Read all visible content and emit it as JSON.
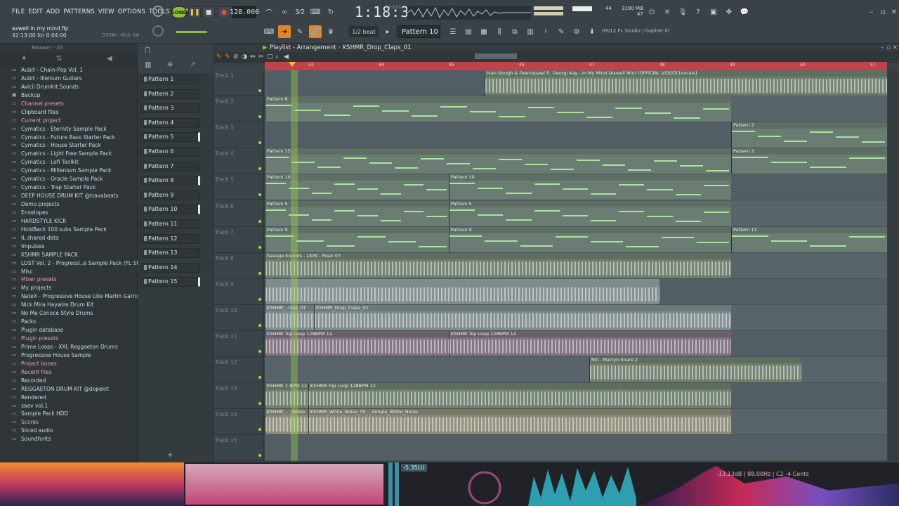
{
  "menu": [
    "FILE",
    "EDIT",
    "ADD",
    "PATTERNS",
    "VIEW",
    "OPTIONS",
    "TOOLS",
    "HELP"
  ],
  "project": {
    "name": "axwell in my mind.flp",
    "time": "42:13:00 for 0:04:00",
    "hint": "D3FAI - Kick 04"
  },
  "transport": {
    "song_label": "SONG",
    "tempo": "128.000",
    "time": "1:18:31",
    "time_unit": "M:S:CS"
  },
  "stats": {
    "poly": "44",
    "mem": "3190 MB",
    "cpu": "47"
  },
  "toolbar": {
    "snap": "1/2 beat",
    "pattern": "Pattern 10",
    "news": "09/12  FL Studio | Gopher it!"
  },
  "browser": {
    "header": "Browser - All",
    "items": [
      {
        "label": "Aubit - Chain-Pop Vol. 1",
        "kind": "folder"
      },
      {
        "label": "Aubit - Illenium Guitars",
        "kind": "folder"
      },
      {
        "label": "Avicii Drumkit.Sounds",
        "kind": "folder"
      },
      {
        "label": "Backup",
        "kind": "folder-open"
      },
      {
        "label": "Channel presets",
        "kind": "pink"
      },
      {
        "label": "Clipboard files",
        "kind": "folder"
      },
      {
        "label": "Current project",
        "kind": "pink"
      },
      {
        "label": "Cymatics - Eternity Sample Pack",
        "kind": "folder"
      },
      {
        "label": "Cymatics - Future Bass Starter Pack",
        "kind": "folder"
      },
      {
        "label": "Cymatics - House Starter Pack",
        "kind": "folder"
      },
      {
        "label": "Cymatics - Light Free Sample Pack",
        "kind": "folder"
      },
      {
        "label": "Cymatics - Lofi Toolkit",
        "kind": "folder"
      },
      {
        "label": "Cymatics - Millenium Sample Pack",
        "kind": "folder"
      },
      {
        "label": "Cymatics - Oracle Sample Pack",
        "kind": "folder"
      },
      {
        "label": "Cymatics - Trap Starter Pack",
        "kind": "folder"
      },
      {
        "label": "DEEP HOUSE DRUM KIT @travabeats",
        "kind": "folder"
      },
      {
        "label": "Demo projects",
        "kind": "folder"
      },
      {
        "label": "Envelopes",
        "kind": "folder"
      },
      {
        "label": "HARDSTYLE KICK",
        "kind": "folder"
      },
      {
        "label": "HoldBack 100 subs Sample Pack",
        "kind": "folder"
      },
      {
        "label": "IL shared data",
        "kind": "folder"
      },
      {
        "label": "Impulses",
        "kind": "folder"
      },
      {
        "label": "KSHMR SAMPLE PACK",
        "kind": "folder"
      },
      {
        "label": "LOST Vol. 2 - Progressi..e Sample Pack (FL Studio)",
        "kind": "folder"
      },
      {
        "label": "Misc",
        "kind": "folder"
      },
      {
        "label": "Mixer presets",
        "kind": "pink"
      },
      {
        "label": "My projects",
        "kind": "folder"
      },
      {
        "label": "NateX - Progressive House Like Martin Garrix FLP",
        "kind": "folder"
      },
      {
        "label": "Nick Mira Haywire Drum Kit",
        "kind": "folder"
      },
      {
        "label": "No Me Conoce Style Drums",
        "kind": "folder"
      },
      {
        "label": "Packs",
        "kind": "folder"
      },
      {
        "label": "Plugin database",
        "kind": "folder"
      },
      {
        "label": "Plugin presets",
        "kind": "pink"
      },
      {
        "label": "Prime Loops - XXL Reggaeton Drums",
        "kind": "folder"
      },
      {
        "label": "Progressive House Sample",
        "kind": "folder"
      },
      {
        "label": "Project bones",
        "kind": "pink"
      },
      {
        "label": "Recent files",
        "kind": "pink"
      },
      {
        "label": "Recorded",
        "kind": "folder"
      },
      {
        "label": "REGGAETON DRUM KIT @dopekit",
        "kind": "folder"
      },
      {
        "label": "Rendered",
        "kind": "folder"
      },
      {
        "label": "saev vol.1",
        "kind": "folder"
      },
      {
        "label": "Sample Pack HDD",
        "kind": "folder"
      },
      {
        "label": "Scores",
        "kind": "pink"
      },
      {
        "label": "Sliced audio",
        "kind": "folder"
      },
      {
        "label": "Soundfonts",
        "kind": "folder"
      }
    ]
  },
  "patterns": [
    "Pattern 1",
    "Pattern 2",
    "Pattern 3",
    "Pattern 4",
    "Pattern 5",
    "Pattern 6",
    "Pattern 7",
    "Pattern 8",
    "Pattern 9",
    "Pattern 10",
    "Pattern 11",
    "Pattern 12",
    "Pattern 13",
    "Pattern 14",
    "Pattern 15"
  ],
  "playlist": {
    "title": "Playlist - Arrangement",
    "breadcrumb": "KSHMR_Drop_Claps_01",
    "bars": [
      "43",
      "44",
      "45",
      "46",
      "47",
      "48",
      "49",
      "50",
      "51"
    ],
    "tracks": [
      "Track 1",
      "Track 2",
      "Track 3",
      "Track 4",
      "Track 5",
      "Track 6",
      "Track 7",
      "Track 8",
      "Track 9",
      "Track 10",
      "Track 11",
      "Track 12",
      "Track 13",
      "Track 14",
      "Track 15"
    ],
    "clips": {
      "t1": "Ivan Gough & Feenixpawl ft. Georgi Kay - In My Mind (Axwell Mix) [OFFICIAL VIDEO] [vocals]",
      "t2": "Pattern 8",
      "t3": "Pattern 2",
      "t4a": "Pattern 15",
      "t4b": "Pattern 3",
      "t5a": "Pattern 10",
      "t5b": "Pattern 10",
      "t6a": "Pattern 5",
      "t6b": "Pattern 5",
      "t7a": "Pattern 9",
      "t7b": "Pattern 9",
      "t7c": "Pattern 11",
      "t8": "Savage Sounds - LION - Riser 07",
      "t10a": "KSHMR_..laps_01",
      "t10b": "KSHMR_Drop_Claps_01",
      "t11a": "KSHMR Top Loop 128BPM 14",
      "t11b": "KSHMR Top Loop 128BPM 14",
      "t12": "NG - Martyn Snare 2",
      "t13a": "KSHMR T..BPM 12",
      "t13b": "KSHMR Top Loop 128BPM 12",
      "t14a": "KSHMR_..._Noise",
      "t14b": "KSHMR_White_Noise_05_-_Simple_White_Noise"
    }
  },
  "visualizer": {
    "lufs": "-5.35LU",
    "readout": "-13.13dB | 88.00Hz | C2 -4 Cents"
  },
  "colors": {
    "accent_green": "#8fbf3a",
    "ruler_red": "#c2414b",
    "playhead": "#f0c44b"
  }
}
